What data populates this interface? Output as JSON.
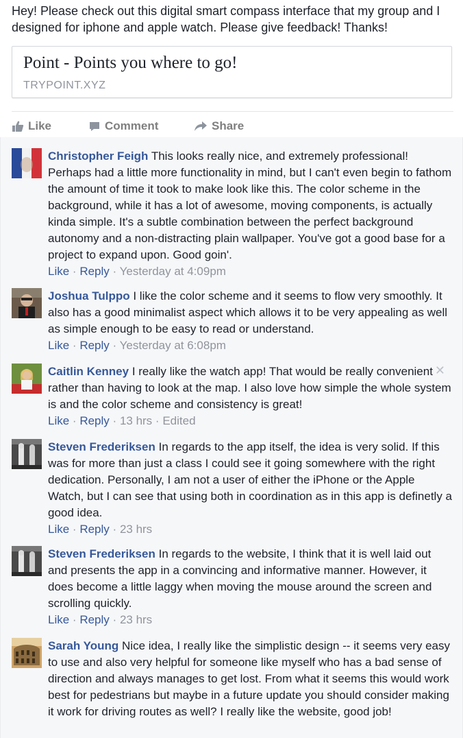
{
  "post": {
    "text": "Hey! Please check out this digital smart compass interface that my group and I designed for iphone and apple watch. Please give feedback! Thanks!",
    "link_title": "Point - Points you where to go!",
    "link_domain": "TRYPOINT.XYZ"
  },
  "actions": {
    "like": "Like",
    "comment": "Comment",
    "share": "Share"
  },
  "comment_actions": {
    "like": "Like",
    "reply": "Reply",
    "sep": "·"
  },
  "comments": [
    {
      "author": "Christopher Feigh",
      "text": "This looks really nice, and extremely professional! Perhaps had a little more functionality in mind, but I can't even begin to fathom the amount of time it took to make look like this. The color scheme in the background, while it has a lot of awesome, moving components, is actually kinda simple. It's a subtle combination between the perfect background autonomy and a non-distracting plain wallpaper. You've got a good base for a project to expand upon. Good goin'.",
      "time": "Yesterday at 4:09pm"
    },
    {
      "author": "Joshua Tulppo",
      "text": "I like the color scheme and it seems to flow very smoothly. It also has a good minimalist aspect which allows it to be very appealing as well as simple enough to be easy to read or understand.",
      "time": "Yesterday at 6:08pm"
    },
    {
      "author": "Caitlin Kenney",
      "text": "I really like the watch app! That would be really convenient rather than having to look at the map. I also love how simple the whole system is and the color scheme and consistency is great!",
      "time": "13 hrs",
      "edited": "Edited",
      "close": "✕"
    },
    {
      "author": "Steven Frederiksen",
      "text": "In regards to the app itself, the idea is very solid. If this was for more than just a class I could see it going somewhere with the right dedication. Personally, I am not a user of either the iPhone or the Apple Watch, but I can see that using both in coordination as in this app is definetly a good idea.",
      "time": "23 hrs"
    },
    {
      "author": "Steven Frederiksen",
      "text": "In regards to the website, I think that it is well laid out and presents the app in a convincing and informative manner. However, it does become a little laggy when moving the mouse around the screen and scrolling quickly.",
      "time": "23 hrs"
    },
    {
      "author": "Sarah Young",
      "text": "Nice idea, I really like the simplistic design -- it seems very easy to use and also very helpful for someone like myself who has a bad sense of direction and always manages to get lost. From what it seems this would work best for pedestrians but maybe in a future update you should consider making it work for driving routes as well? I really like the website, good job!"
    }
  ],
  "colors": {
    "link_blue": "#365899",
    "meta_gray": "#90949c",
    "comment_bg": "#f6f7f9"
  }
}
